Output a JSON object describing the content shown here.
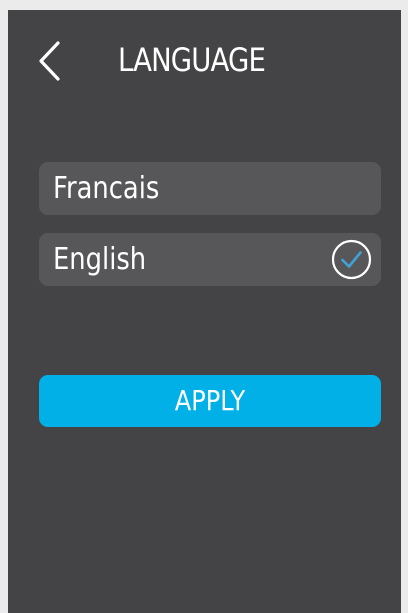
{
  "header": {
    "title": "LANGUAGE",
    "back_icon": "chevron-left-icon"
  },
  "languages": [
    {
      "label": "Francais",
      "selected": false
    },
    {
      "label": "English",
      "selected": true,
      "icon": "check-circle-icon"
    }
  ],
  "apply_label": "APPLY",
  "colors": {
    "background": "#444446",
    "option_background": "#575759",
    "accent": "#00b0e6",
    "check": "#3fa3d8",
    "text": "#ffffff"
  }
}
